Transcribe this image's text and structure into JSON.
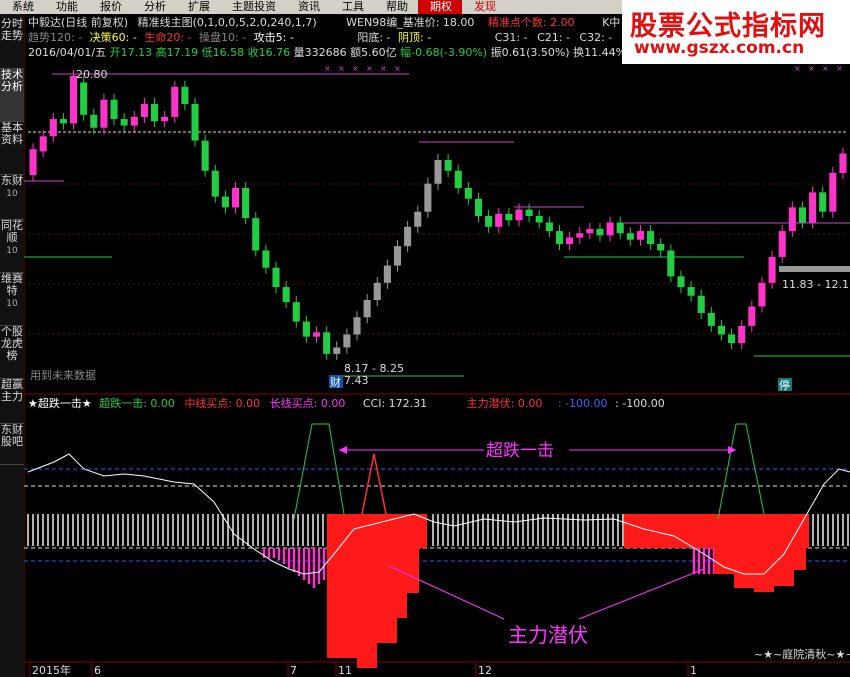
{
  "menu": [
    "系统",
    "功能",
    "报价",
    "分析",
    "扩展",
    "主题投资",
    "资讯",
    "工具",
    "帮助",
    "期权",
    "发现"
  ],
  "logo": {
    "line1": "股票公式指标网",
    "line2": "www.gszx.com.cn"
  },
  "sidebar": [
    {
      "label": "分时走势"
    },
    {
      "label": "技术分析"
    },
    {
      "label": "基本资料"
    },
    {
      "label": "东财",
      "sub": "10"
    },
    {
      "label": "同花顺",
      "sub": "10"
    },
    {
      "label": "维赛特",
      "sub": "10"
    },
    {
      "label": "个股龙虎榜"
    },
    {
      "label": "超赢主力"
    },
    {
      "label": "东财股吧"
    }
  ],
  "header": {
    "stock": "中毅达(日线 前复权)",
    "formula": "精准线主图(0,1,0,0,5,2,0,240,1,7)",
    "wen": "WEN98编_基准价: 18.00",
    "precise": "精准点个数: 2.00",
    "k": "K中",
    "line2_a": "趋势120: -",
    "line2_b": "决策60: -",
    "line2_c": "生命20: -",
    "line2_d": "操盘10: -",
    "line2_e": "攻击5: -",
    "yang": "阳底: -",
    "yin": "阴顶: -",
    "c31": "C31: -",
    "c21": "C21: -",
    "c32": "C32: -",
    "date": "2016/04/01/五",
    "open": "开17.13",
    "high": "高17.19",
    "low": "低16.58",
    "close": "收16.76",
    "vol": "量332686",
    "amount": "额5.60亿",
    "chg": "幅-0.68(-3.90%)",
    "amp": "振0.61(3.50%)",
    "turn": "换11.44%"
  },
  "main_chart": {
    "high_label": "20.80",
    "low_label": "7.43",
    "range_label_low": "8.17 - 8.25",
    "range_label_right": "11.83 - 12.1",
    "future_note": "用到未来数据",
    "marker_cai": "财",
    "marker_ting": "停"
  },
  "sub_header": {
    "title": "★超跌一击★",
    "cdyj": "超跌一击: 0.00",
    "zx": "中线买点: 0.00",
    "cx": "长线买点: 0.00",
    "cci": "CCI: 172.31",
    "zlqf": "主力潜伏: 0.00",
    "v1": ": -100.00",
    "v2": ": -100.00"
  },
  "sub_chart": {
    "annotation_top": "超跌一击",
    "annotation_bottom": "主力潜伏",
    "signature": "~★~庭院清秋~★~"
  },
  "xaxis": {
    "labels": [
      "2015年",
      "6",
      "7",
      "11",
      "12",
      "1"
    ]
  },
  "colors": {
    "up": "#ff33cc",
    "down": "#22cc44",
    "flat": "#999999",
    "accent": "#ff0000",
    "bg": "#000000"
  },
  "chart_data": {
    "type": "candlestick",
    "ylim": [
      7.43,
      20.8
    ],
    "candles": [
      {
        "o": 16.2,
        "c": 17.4
      },
      {
        "o": 17.3,
        "c": 18.0
      },
      {
        "o": 18.0,
        "c": 18.8
      },
      {
        "o": 18.8,
        "c": 18.6
      },
      {
        "o": 18.6,
        "c": 20.8
      },
      {
        "o": 20.5,
        "c": 19.0
      },
      {
        "o": 19.0,
        "c": 18.4
      },
      {
        "o": 18.4,
        "c": 19.7
      },
      {
        "o": 19.7,
        "c": 18.8
      },
      {
        "o": 18.8,
        "c": 18.5
      },
      {
        "o": 18.5,
        "c": 18.9
      },
      {
        "o": 18.9,
        "c": 19.5
      },
      {
        "o": 19.5,
        "c": 18.7
      },
      {
        "o": 18.7,
        "c": 18.9
      },
      {
        "o": 18.9,
        "c": 20.3
      },
      {
        "o": 20.3,
        "c": 19.5
      },
      {
        "o": 19.5,
        "c": 17.8
      },
      {
        "o": 17.8,
        "c": 16.4
      },
      {
        "o": 16.4,
        "c": 15.2
      },
      {
        "o": 15.2,
        "c": 14.7
      },
      {
        "o": 14.7,
        "c": 15.6
      },
      {
        "o": 15.6,
        "c": 14.2
      },
      {
        "o": 14.2,
        "c": 12.7
      },
      {
        "o": 12.7,
        "c": 11.9
      },
      {
        "o": 11.9,
        "c": 11.0
      },
      {
        "o": 11.0,
        "c": 10.3
      },
      {
        "o": 10.3,
        "c": 9.4
      },
      {
        "o": 9.4,
        "c": 8.7
      },
      {
        "o": 8.7,
        "c": 8.9
      },
      {
        "o": 8.9,
        "c": 7.9
      },
      {
        "o": 7.9,
        "c": 8.2
      },
      {
        "o": 8.2,
        "c": 8.8
      },
      {
        "o": 8.8,
        "c": 9.6
      },
      {
        "o": 9.6,
        "c": 10.4
      },
      {
        "o": 10.4,
        "c": 11.2
      },
      {
        "o": 11.2,
        "c": 12.0
      },
      {
        "o": 12.0,
        "c": 12.9
      },
      {
        "o": 12.9,
        "c": 13.8
      },
      {
        "o": 13.8,
        "c": 14.5
      },
      {
        "o": 14.5,
        "c": 15.8
      },
      {
        "o": 15.8,
        "c": 16.9
      },
      {
        "o": 16.9,
        "c": 16.4
      },
      {
        "o": 16.4,
        "c": 15.6
      },
      {
        "o": 15.6,
        "c": 15.1
      },
      {
        "o": 15.1,
        "c": 14.3
      },
      {
        "o": 14.3,
        "c": 13.8
      },
      {
        "o": 13.8,
        "c": 14.4
      },
      {
        "o": 14.4,
        "c": 14.1
      },
      {
        "o": 14.1,
        "c": 14.6
      },
      {
        "o": 14.6,
        "c": 14.3
      },
      {
        "o": 14.3,
        "c": 14.0
      },
      {
        "o": 14.0,
        "c": 13.6
      },
      {
        "o": 13.6,
        "c": 13.0
      },
      {
        "o": 13.0,
        "c": 13.3
      },
      {
        "o": 13.3,
        "c": 13.5
      },
      {
        "o": 13.5,
        "c": 13.7
      },
      {
        "o": 13.7,
        "c": 13.4
      },
      {
        "o": 13.4,
        "c": 14.0
      },
      {
        "o": 14.0,
        "c": 13.5
      },
      {
        "o": 13.5,
        "c": 13.2
      },
      {
        "o": 13.2,
        "c": 13.6
      },
      {
        "o": 13.6,
        "c": 13.0
      },
      {
        "o": 13.0,
        "c": 12.7
      },
      {
        "o": 12.7,
        "c": 11.5
      },
      {
        "o": 11.5,
        "c": 11.0
      },
      {
        "o": 11.0,
        "c": 10.6
      },
      {
        "o": 10.6,
        "c": 9.8
      },
      {
        "o": 9.8,
        "c": 9.2
      },
      {
        "o": 9.2,
        "c": 8.8
      },
      {
        "o": 8.8,
        "c": 8.4
      },
      {
        "o": 8.4,
        "c": 9.2
      },
      {
        "o": 9.2,
        "c": 10.1
      },
      {
        "o": 10.1,
        "c": 11.2
      },
      {
        "o": 11.2,
        "c": 12.4
      },
      {
        "o": 12.4,
        "c": 13.6
      },
      {
        "o": 13.6,
        "c": 14.7
      },
      {
        "o": 14.7,
        "c": 14.0
      },
      {
        "o": 14.0,
        "c": 15.4
      },
      {
        "o": 15.4,
        "c": 14.5
      },
      {
        "o": 14.5,
        "c": 16.3
      },
      {
        "o": 16.3,
        "c": 17.2
      }
    ],
    "cdyj_signal_index": [
      21,
      68
    ],
    "zx_signal_index": [
      34
    ]
  }
}
